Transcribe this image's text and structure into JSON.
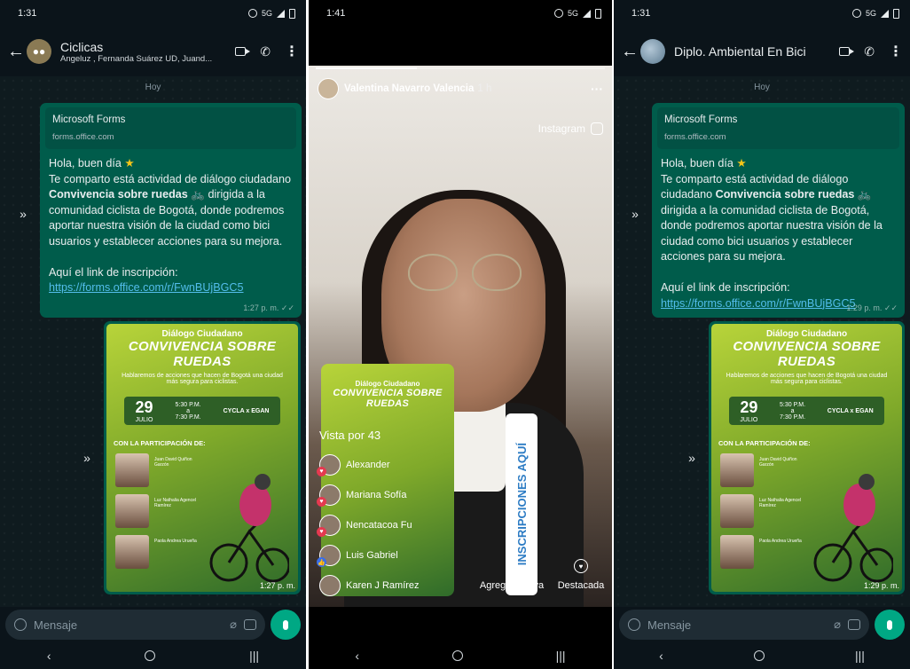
{
  "left": {
    "status_time": "1:31",
    "status_net": "5G",
    "chat_title": "Ciclicas",
    "chat_subtitle": "Angeluz , Fernanda Suárez UD, Juand...",
    "date_chip": "Hoy",
    "preview_title": "Microsoft Forms",
    "preview_domain": "forms.office.com",
    "msg_greeting": "Hola, buen día",
    "msg_line1": "Te comparto está actividad de diálogo ciudadano",
    "msg_bold": "Convivencia sobre ruedas",
    "msg_line2": "dirigida a la comunidad ciclista de Bogotá, donde podremos aportar nuestra visión de la ciudad como bici usuarios y establecer acciones para su mejora.",
    "msg_link_intro": "Aquí el link de inscripción:",
    "msg_link": "https://forms.office.com/r/FwnBUjBGC5",
    "msg_time": "1:27 p. m.",
    "img_time": "1:27 p. m.",
    "composer_placeholder": "Mensaje"
  },
  "right": {
    "status_time": "1:31",
    "status_net": "5G",
    "chat_title": "Diplo. Ambiental En Bici",
    "date_chip": "Hoy",
    "preview_title": "Microsoft Forms",
    "preview_domain": "forms.office.com",
    "msg_greeting": "Hola, buen día",
    "msg_line1": "Te comparto está actividad de diálogo ciudadano",
    "msg_bold": "Convivencia sobre ruedas",
    "msg_line2": "dirigida a la comunidad ciclista de Bogotá, donde podremos aportar nuestra visión de la ciudad como bici usuarios y establecer acciones para su mejora.",
    "msg_link_intro": "Aquí el link de inscripción:",
    "msg_link": "https://forms.office.com/r/FwnBUjBGC5",
    "msg_time": "1:29 p. m.",
    "img_time": "1:29 p. m.",
    "composer_placeholder": "Mensaje"
  },
  "poster": {
    "tag": "Diálogo Ciudadano",
    "title": "CONVIVENCIA SOBRE RUEDAS",
    "subtitle": "Hablaremos de acciones que hacen de Bogotá una ciudad más segura para ciclistas.",
    "day": "29",
    "month": "JULIO",
    "time_from": "5:30 P.M.",
    "time_to": "7:30 P.M.",
    "venue": "CYCLA x EGAN",
    "participation": "CON LA PARTICIPACIÓN DE:",
    "speaker1": "Juan David Quiñon Garzón",
    "speaker2": "Luz Nathalia Agencel Ramírez",
    "speaker3": "Paola Andrea Urueña"
  },
  "story": {
    "status_time": "1:41",
    "status_net": "5G",
    "user_name": "Valentina Navarro Valencia",
    "time_ago": "1 h",
    "source": "Instagram",
    "viewers_label": "Vista por",
    "viewers_count": "43",
    "viewers": [
      "Alexander",
      "Mariana Sofía",
      "Nencatacoa Fu",
      "Luis Gabriel",
      "Karen J Ramírez"
    ],
    "sticker": "INSCRIPCIONES AQUÍ",
    "add_new": "Agregar nueva",
    "highlight": "Destacada"
  },
  "colors": {
    "bubble": "#005c4b",
    "background": "#0b141a",
    "link": "#53bdeb",
    "mic": "#00a884"
  }
}
